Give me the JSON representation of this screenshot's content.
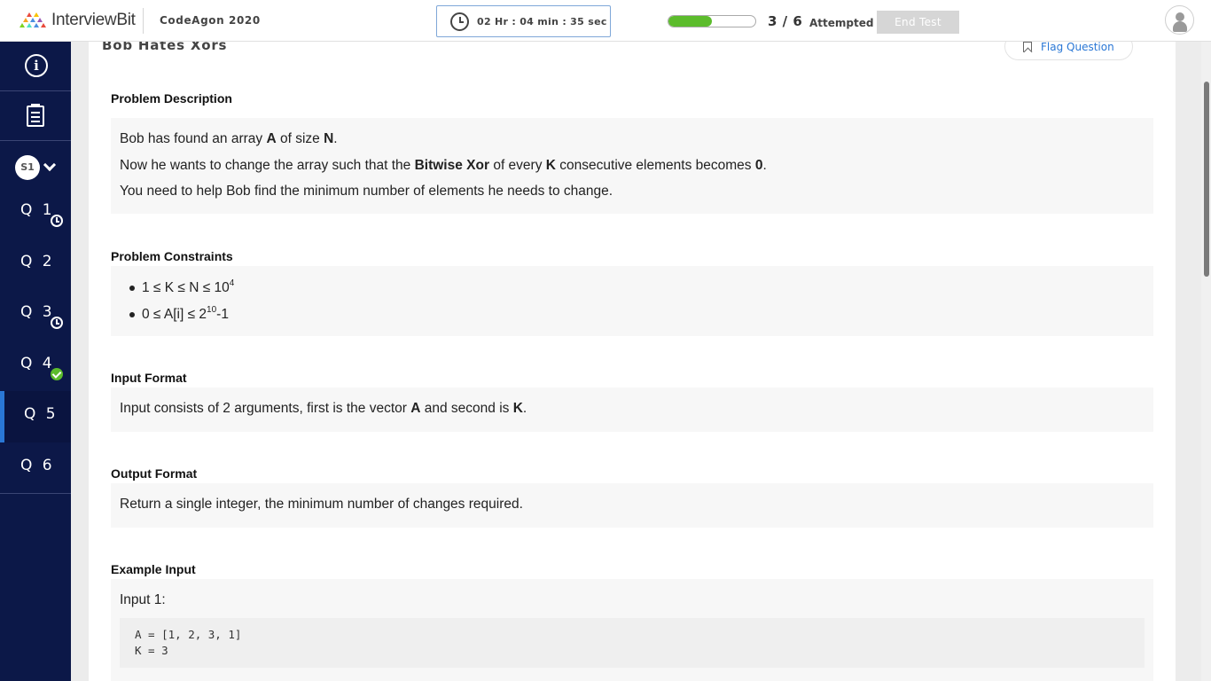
{
  "header": {
    "logo_text": "InterviewBit",
    "contest_name": "CodeAgon 2020",
    "timer": "02 Hr : 04 min : 35 sec",
    "progress_fraction": 0.5,
    "attempted_count": "3 / 6",
    "attempted_label": "Attempted",
    "end_test_label": "End Test",
    "progress_color": "#5cbc2c"
  },
  "sidebar": {
    "section_badge": "S1",
    "questions": [
      {
        "label": "Q 1",
        "status": "clock"
      },
      {
        "label": "Q 2",
        "status": "none"
      },
      {
        "label": "Q 3",
        "status": "clock"
      },
      {
        "label": "Q 4",
        "status": "done"
      },
      {
        "label": "Q 5",
        "status": "active"
      },
      {
        "label": "Q 6",
        "status": "none"
      }
    ],
    "bg_color": "#0c1848",
    "active_color": "#2a77d5"
  },
  "question": {
    "title": "Bob Hates Xors",
    "flag_label": "Flag Question",
    "description": {
      "heading": "Problem Description",
      "line1": {
        "a": "Bob has found an array ",
        "b": "A",
        "c": " of size ",
        "d": "N",
        "e": "."
      },
      "line2": {
        "a": "Now he wants to change the array such that the ",
        "b": "Bitwise Xor",
        "c": " of every ",
        "d": "K",
        "e": " consecutive elements becomes ",
        "f": "0",
        "g": "."
      },
      "line3": "You need to help Bob find the minimum number of elements he needs to change."
    },
    "constraints": {
      "heading": "Problem Constraints",
      "c1": {
        "text": "1 ≤ K ≤ N ≤ 10",
        "sup": "4"
      },
      "c2": {
        "text": "0 ≤ A[i] ≤ 2",
        "sup": "10",
        "tail": "-1"
      }
    },
    "input_format": {
      "heading": "Input Format",
      "a": "Input consists of 2 arguments, first is the vector ",
      "b": "A",
      "c": " and second is ",
      "d": "K",
      "e": "."
    },
    "output_format": {
      "heading": "Output Format",
      "text": "Return a single integer, the minimum number of changes required."
    },
    "example_input": {
      "heading": "Example Input",
      "label": "Input 1:",
      "code_line1": "A = [1, 2, 3, 1]",
      "code_line2": "K = 3"
    }
  }
}
